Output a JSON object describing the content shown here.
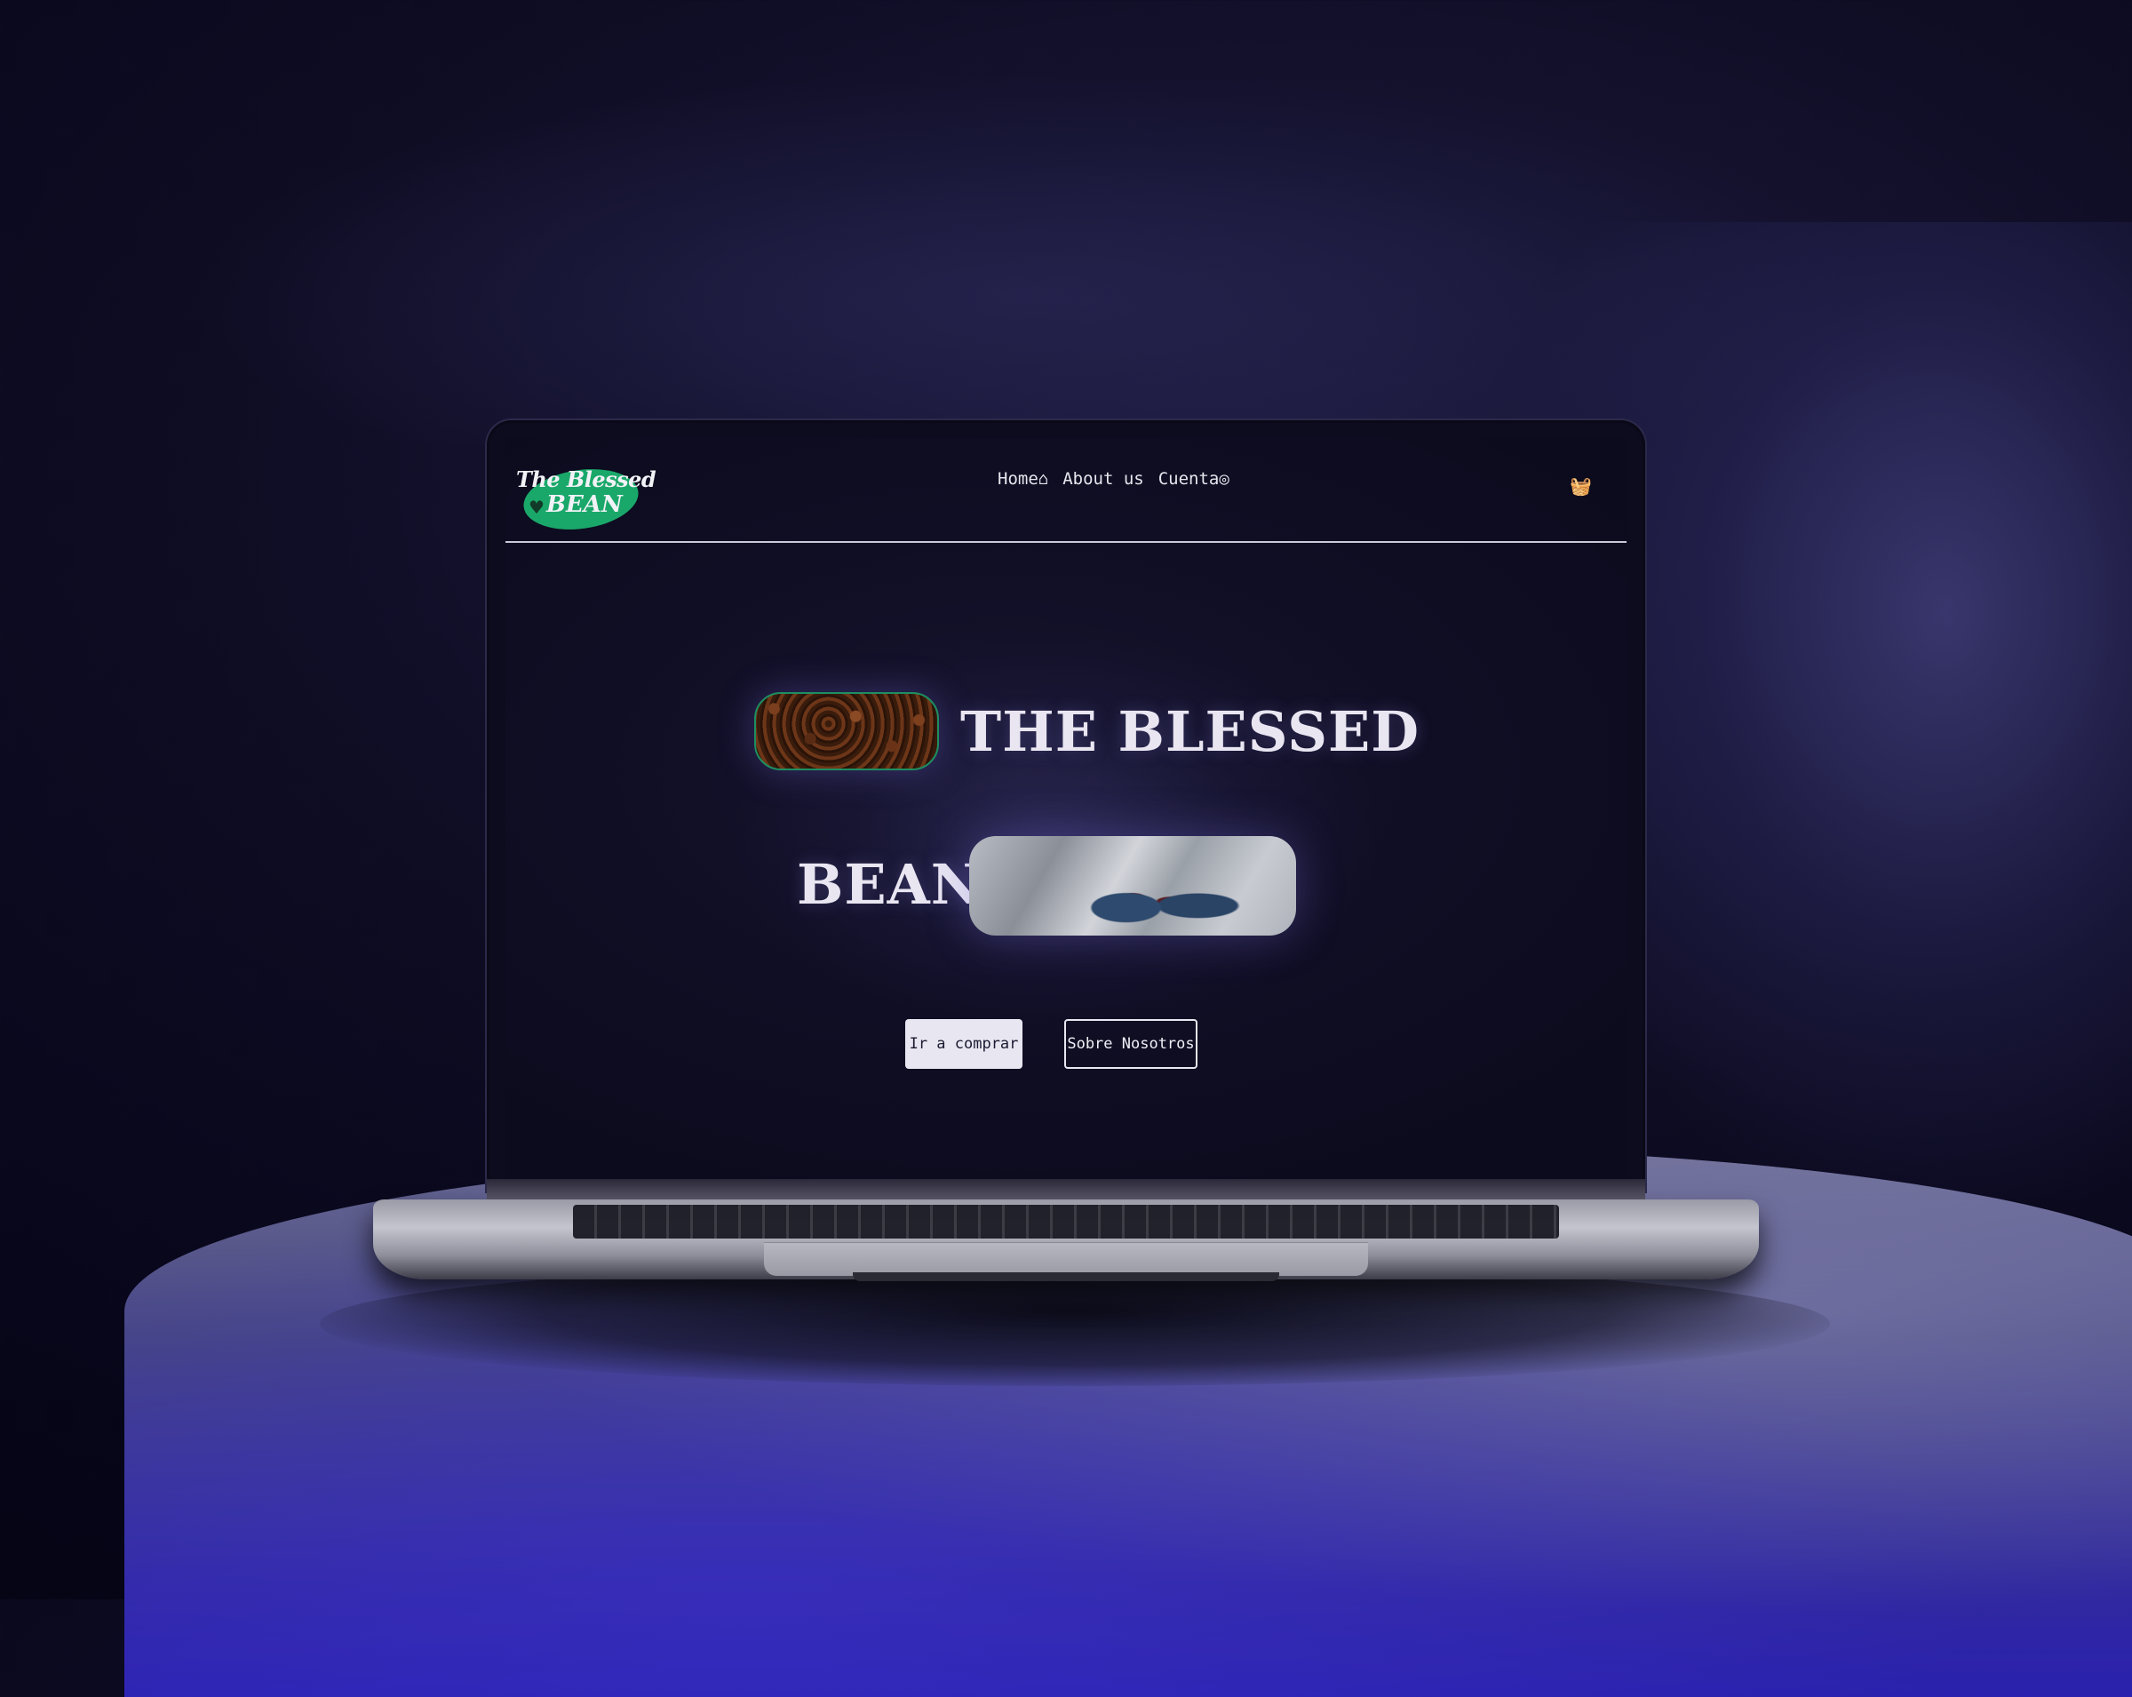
{
  "site": {
    "logo": {
      "line1": "The Blessed",
      "line2": "BEAN",
      "heart": "♥"
    },
    "nav": {
      "items": [
        {
          "label": "Home⌂",
          "icon": "home-icon"
        },
        {
          "label": "About us"
        },
        {
          "label": "Cuenta◎",
          "icon": "account-icon"
        }
      ],
      "cart_icon": "🧺"
    },
    "hero": {
      "line1": "THE BLESSED",
      "line2": "BEAN"
    },
    "buttons": {
      "primary": "Ir a comprar",
      "secondary": "Sobre Nosotros"
    }
  },
  "colors": {
    "logo_green": "#1aa86a",
    "screen_bg": "#100e24",
    "text_light": "#e9e6f2",
    "button_light": "#e8e6f0"
  }
}
